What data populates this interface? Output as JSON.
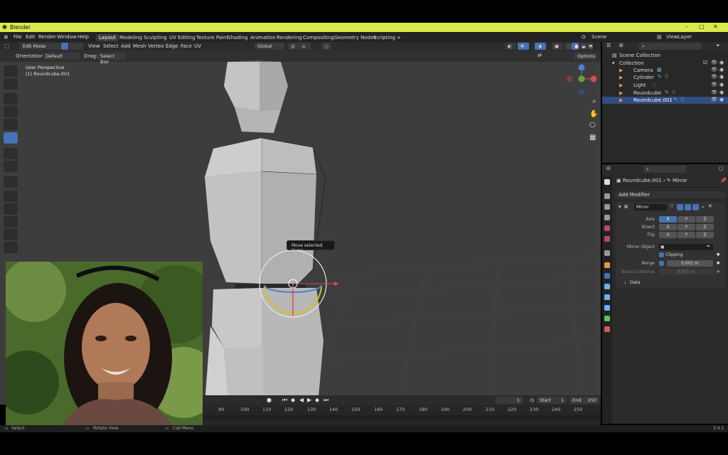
{
  "app": {
    "title": "Blender",
    "version": "3.4.1"
  },
  "menu": [
    "File",
    "Edit",
    "Render",
    "Window",
    "Help"
  ],
  "workspaces": [
    "Layout",
    "Modeling",
    "Sculpting",
    "UV Editing",
    "Texture Paint",
    "Shading",
    "Animation",
    "Rendering",
    "Compositing",
    "Geometry Nodes",
    "Scripting",
    "+"
  ],
  "active_workspace": "Layout",
  "scene": {
    "scene_label": "Scene",
    "view_layer_label": "ViewLayer"
  },
  "viewport_header": {
    "mode": "Edit Mode",
    "menus": [
      "View",
      "Select",
      "Add",
      "Mesh",
      "Vertex",
      "Edge",
      "Face",
      "UV"
    ],
    "transform": "Global",
    "options": "Options"
  },
  "tool_settings": {
    "orientation_label": "Orientation:",
    "orientation": "Default",
    "drag_label": "Drag:",
    "drag": "Select Box"
  },
  "viewport_info": {
    "perspective": "User Perspective",
    "object": "(1) Roundcube.001"
  },
  "tooltip": "Move selected items",
  "timeline": {
    "frame": "1",
    "start_label": "Start",
    "start": "1",
    "end_label": "End",
    "end": "250",
    "ticks": [
      "90",
      "100",
      "110",
      "120",
      "130",
      "140",
      "150",
      "160",
      "170",
      "180",
      "190",
      "200",
      "210",
      "220",
      "230",
      "240",
      "250"
    ]
  },
  "statusbar": {
    "select": "Select",
    "rotate": "Rotate View",
    "menu": "Call Menu",
    "version": "3.4.1"
  },
  "outliner": {
    "root": "Scene Collection",
    "collection": "Collection",
    "items": [
      "Camera",
      "Cylinder",
      "Light",
      "Roundcube",
      "Roundcube.001"
    ],
    "selected": "Roundcube.001"
  },
  "properties": {
    "object": "Roundcube.001",
    "modifier_crumb": "Mirror",
    "add_modifier": "Add Modifier",
    "modifier_name": "Mirror",
    "axis_label": "Axis",
    "bisect_label": "Bisect",
    "flip_label": "Flip",
    "xyz": [
      "X",
      "Y",
      "Z"
    ],
    "mirror_object_label": "Mirror Object",
    "clipping_label": "Clipping",
    "merge_label": "Merge",
    "merge_value": "0.001 m",
    "bisect_distance_label": "Bisect Distance",
    "bisect_distance_value": "0.001 m",
    "data_label": "Data"
  },
  "colors": {
    "accent": "#4772b3",
    "titlebar": "#d9ec4a",
    "viewport": "#3d3d3d"
  }
}
